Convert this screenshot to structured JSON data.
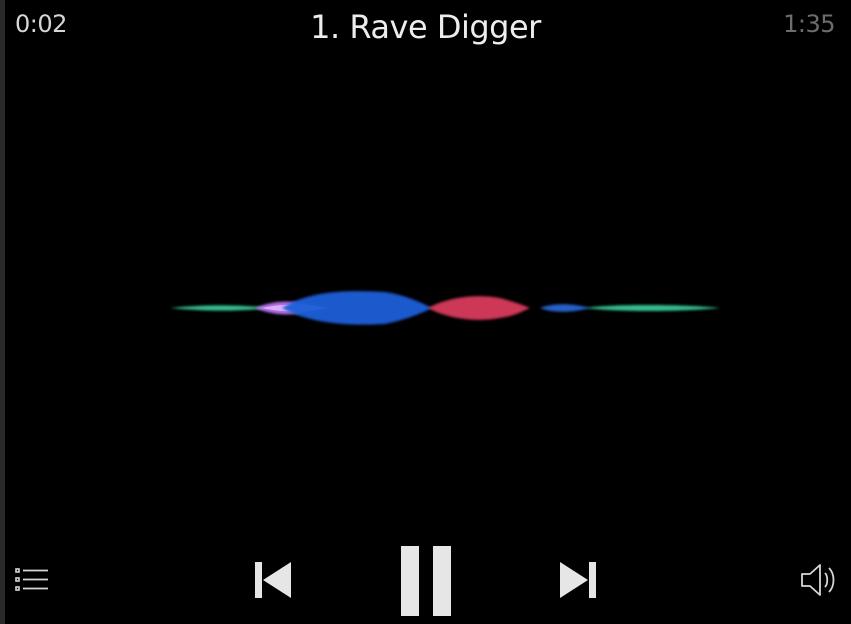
{
  "player": {
    "elapsed_time": "0:02",
    "track_title": "1. Rave Digger",
    "total_time": "1:35"
  },
  "controls": {
    "playlist_icon": "playlist-icon",
    "previous_icon": "skip-previous-icon",
    "pause_icon": "pause-icon",
    "next_icon": "skip-next-icon",
    "volume_icon": "volume-icon"
  },
  "visualizer_colors": {
    "teal": "#3de0a8",
    "violet": "#c77bff",
    "blue": "#1f5fd8",
    "red": "#d83a5c",
    "line": "#cfd8e0"
  }
}
